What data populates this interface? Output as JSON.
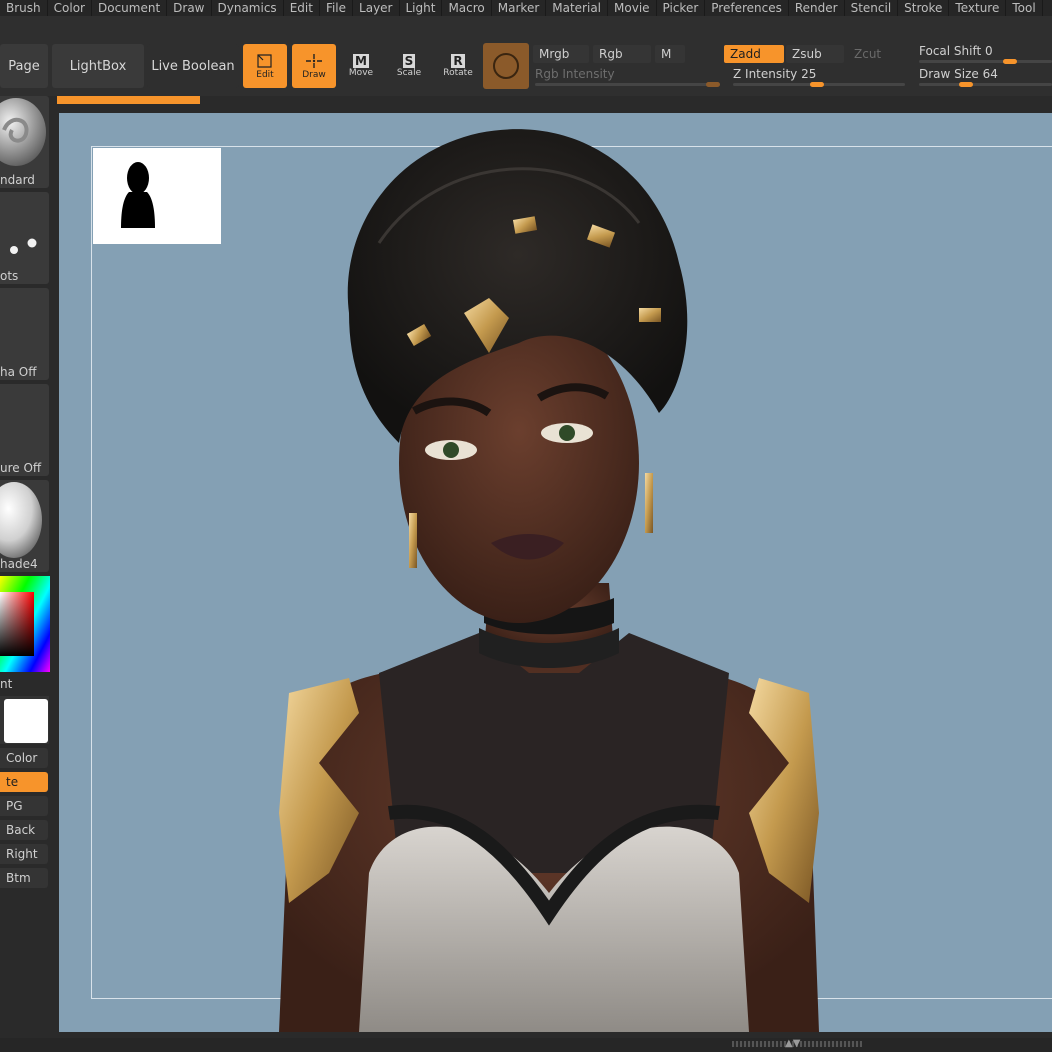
{
  "menu": [
    "Brush",
    "Color",
    "Document",
    "Draw",
    "Dynamics",
    "Edit",
    "File",
    "Layer",
    "Light",
    "Macro",
    "Marker",
    "Material",
    "Movie",
    "Picker",
    "Preferences",
    "Render",
    "Stencil",
    "Stroke",
    "Texture",
    "Tool"
  ],
  "toolbar": {
    "page_label": "Page",
    "lightbox_label": "LightBox",
    "live_boolean_label": "Live Boolean",
    "edit_label": "Edit",
    "draw_label": "Draw",
    "move_label": "Move",
    "scale_label": "Scale",
    "rotate_label": "Rotate",
    "move_key": "M",
    "scale_key": "S",
    "rotate_key": "R",
    "mrgb_label": "Mrgb",
    "rgb_label": "Rgb",
    "m_label": "M",
    "rgb_intensity_label": "Rgb Intensity",
    "zadd_label": "Zadd",
    "zsub_label": "Zsub",
    "zcut_label": "Zcut",
    "z_intensity_label": "Z Intensity",
    "z_intensity_value": "25",
    "focal_shift_label": "Focal Shift",
    "focal_shift_value": "0",
    "draw_size_label": "Draw Size",
    "draw_size_value": "64"
  },
  "left_panel": {
    "brush_label": "ndard",
    "stroke_label": "ots",
    "alpha_label": "ha Off",
    "texture_label": "ure Off",
    "material_label": "hade4",
    "gradient_label": "nt",
    "switch_color_label": "Color",
    "alternate_label": "te",
    "jpg_label": "PG",
    "back_label": "Back",
    "right_label": "Right",
    "btm_label": "Btm"
  },
  "colors": {
    "accent": "#f7942b",
    "canvas_bg": "#84a0b4",
    "panel_bg": "#2f2f2f"
  }
}
